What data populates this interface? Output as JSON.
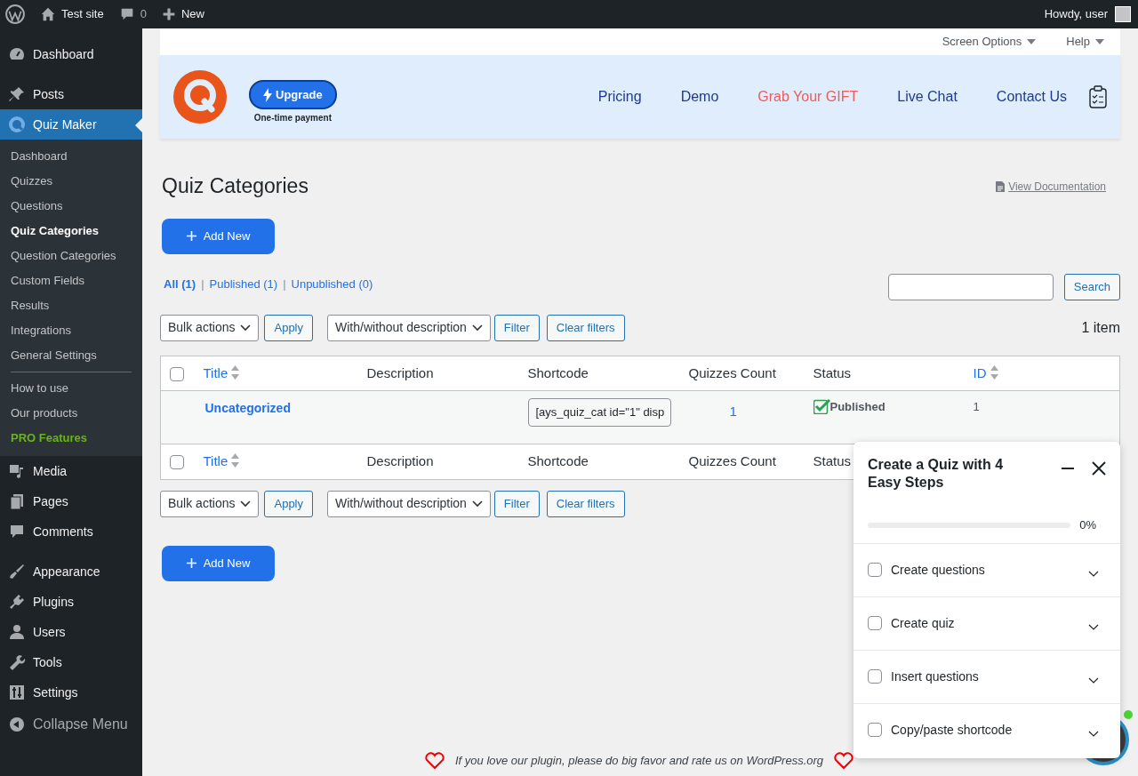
{
  "admin_bar": {
    "site": "Test site",
    "comments": "0",
    "new": "New",
    "greeting": "Howdy, user"
  },
  "sidebar": {
    "groups": [
      [
        {
          "label": "Dashboard",
          "selected": false
        }
      ],
      [
        {
          "label": "Posts",
          "selected": false
        },
        {
          "label": "Quiz Maker",
          "selected": true,
          "children": [
            {
              "label": "Dashboard",
              "selected": false,
              "kind": "link"
            },
            {
              "label": "Quizzes",
              "selected": false,
              "kind": "link"
            },
            {
              "label": "Questions",
              "selected": false,
              "kind": "link"
            },
            {
              "label": "Quiz Categories",
              "selected": true,
              "kind": "link"
            },
            {
              "label": "Question Categories",
              "selected": false,
              "kind": "link"
            },
            {
              "label": "Custom Fields",
              "selected": false,
              "kind": "link"
            },
            {
              "label": "Results",
              "selected": false,
              "kind": "link"
            },
            {
              "label": "Integrations",
              "selected": false,
              "kind": "link"
            },
            {
              "label": "General Settings",
              "selected": false,
              "kind": "link"
            },
            {
              "kind": "divider"
            },
            {
              "label": "How to use",
              "selected": false,
              "kind": "link"
            },
            {
              "label": "Our products",
              "selected": false,
              "kind": "link"
            },
            {
              "label": "PRO Features",
              "selected": false,
              "kind": "pro"
            }
          ]
        },
        {
          "label": "Media",
          "selected": false
        },
        {
          "label": "Pages",
          "selected": false
        },
        {
          "label": "Comments",
          "selected": false
        }
      ],
      [
        {
          "label": "Appearance",
          "selected": false
        },
        {
          "label": "Plugins",
          "selected": false
        },
        {
          "label": "Users",
          "selected": false
        },
        {
          "label": "Tools",
          "selected": false
        },
        {
          "label": "Settings",
          "selected": false
        },
        {
          "label": "Collapse Menu",
          "selected": false
        }
      ]
    ]
  },
  "screen_meta": [
    "Screen Options",
    "Help"
  ],
  "banner": {
    "upgrade": "Upgrade",
    "upgrade_note": "One-time payment",
    "links": [
      {
        "label": "Pricing",
        "kind": "normal"
      },
      {
        "label": "Demo",
        "kind": "normal"
      },
      {
        "label": "Grab Your GIFT",
        "kind": "highlight"
      },
      {
        "label": "Live Chat",
        "kind": "normal"
      },
      {
        "label": "Contact Us",
        "kind": "normal"
      }
    ]
  },
  "page": {
    "title": "Quiz Categories",
    "doc_link": "View Documentation",
    "add_new_top": "Add New",
    "add_new_bottom": "Add New",
    "views": [
      {
        "label": "All (1)",
        "selected": true
      },
      {
        "label": "Published (1)",
        "selected": false
      },
      {
        "label": "Unpublished (0)",
        "selected": false
      }
    ],
    "view_separators": [
      "|",
      "|"
    ],
    "search_button": "Search",
    "top_toolbar": {
      "bulk": "Bulk actions",
      "apply": "Apply",
      "desc_filter": "With/without description",
      "filter": "Filter",
      "clear": "Clear filters",
      "count": "1 item"
    },
    "bottom_toolbar": {
      "bulk": "Bulk actions",
      "apply": "Apply",
      "desc_filter": "With/without description",
      "filter": "Filter",
      "clear": "Clear filters"
    }
  },
  "table": {
    "select_all_checked": false,
    "footer_select_all_checked": false,
    "columns": [
      {
        "label": "Title",
        "sortable": true
      },
      {
        "label": "Description",
        "sortable": false
      },
      {
        "label": "Shortcode",
        "sortable": false
      },
      {
        "label": "Quizzes Count",
        "sortable": false
      },
      {
        "label": "Status",
        "sortable": false
      },
      {
        "label": "ID",
        "sortable": true
      }
    ],
    "footer_columns": [
      {
        "label": "Title",
        "sortable": true
      },
      {
        "label": "Description",
        "sortable": false
      },
      {
        "label": "Shortcode",
        "sortable": false
      },
      {
        "label": "Quizzes Count",
        "sortable": false
      },
      {
        "label": "Status",
        "sortable": false
      }
    ],
    "rows": [
      {
        "title": "Uncategorized",
        "shortcode": "[ays_quiz_cat id=\"1\" disp",
        "count": "1",
        "status": "Published",
        "published": true,
        "id": "1"
      }
    ]
  },
  "steps_panel": {
    "title": "Create a Quiz with 4 Easy Steps",
    "level": 0,
    "reading": "0%",
    "steps": [
      {
        "label": "Create questions",
        "checked": false
      },
      {
        "label": "Create quiz",
        "checked": false
      },
      {
        "label": "Insert questions",
        "checked": false
      },
      {
        "label": "Copy/paste shortcode",
        "checked": false
      }
    ]
  },
  "footer": {
    "text": "If you love our plugin, please do big favor and rate us on ",
    "link": "WordPress.org"
  }
}
